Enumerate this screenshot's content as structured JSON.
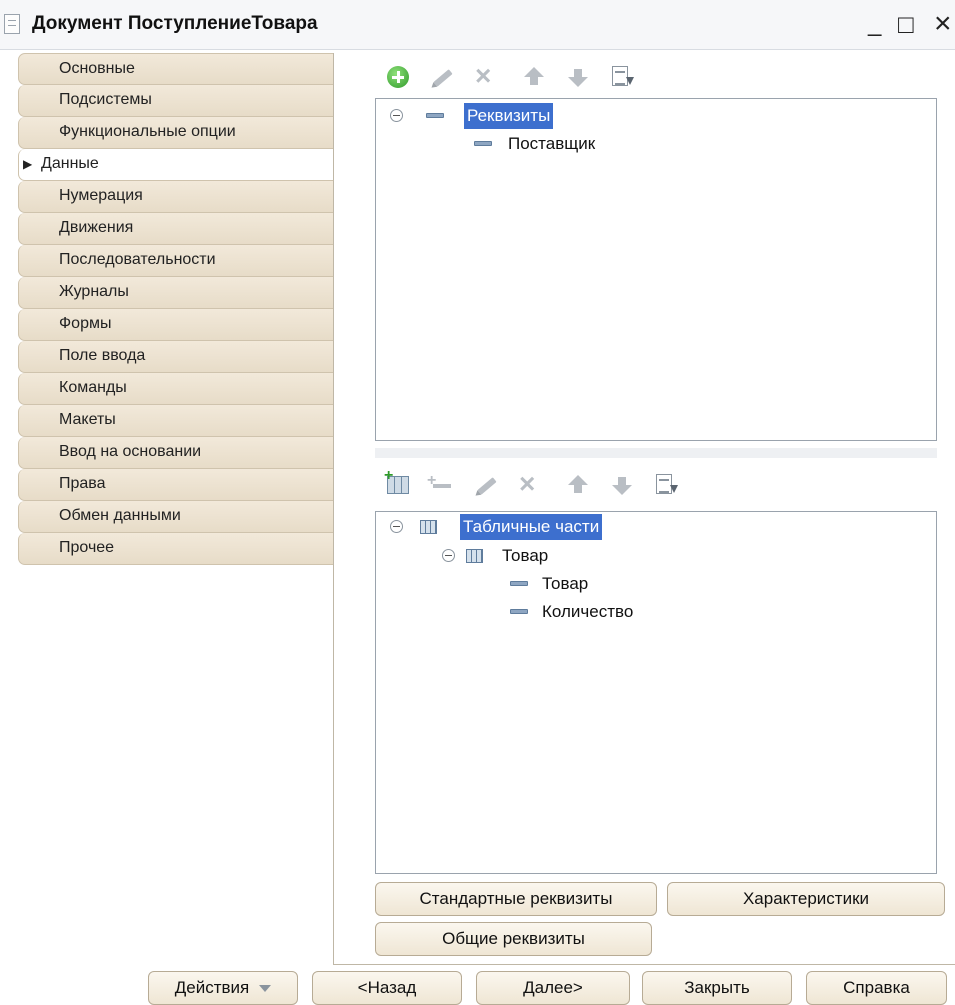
{
  "window": {
    "title": "Документ ПоступлениеТовара",
    "minimize": "_",
    "maximize": "□",
    "close": "×"
  },
  "nav": {
    "items": [
      {
        "label": "Основные"
      },
      {
        "label": "Подсистемы"
      },
      {
        "label": "Функциональные опции"
      },
      {
        "label": "Данные",
        "active": true
      },
      {
        "label": "Нумерация"
      },
      {
        "label": "Движения"
      },
      {
        "label": "Последовательности"
      },
      {
        "label": "Журналы"
      },
      {
        "label": "Формы"
      },
      {
        "label": "Поле ввода"
      },
      {
        "label": "Команды"
      },
      {
        "label": "Макеты"
      },
      {
        "label": "Ввод на основании"
      },
      {
        "label": "Права"
      },
      {
        "label": "Обмен данными"
      },
      {
        "label": "Прочее"
      }
    ]
  },
  "attributes_tree": {
    "root": "Реквизиты",
    "children": [
      "Поставщик"
    ]
  },
  "tabular_tree": {
    "root": "Табличные части",
    "child": "Товар",
    "grandchildren": [
      "Товар",
      "Количество"
    ]
  },
  "buttons": {
    "standard_attributes": "Стандартные реквизиты",
    "characteristics": "Характеристики",
    "common_attributes": "Общие реквизиты"
  },
  "footer": {
    "actions": "Действия",
    "back": "<Назад",
    "next": "Далее>",
    "close": "Закрыть",
    "help": "Справка"
  }
}
